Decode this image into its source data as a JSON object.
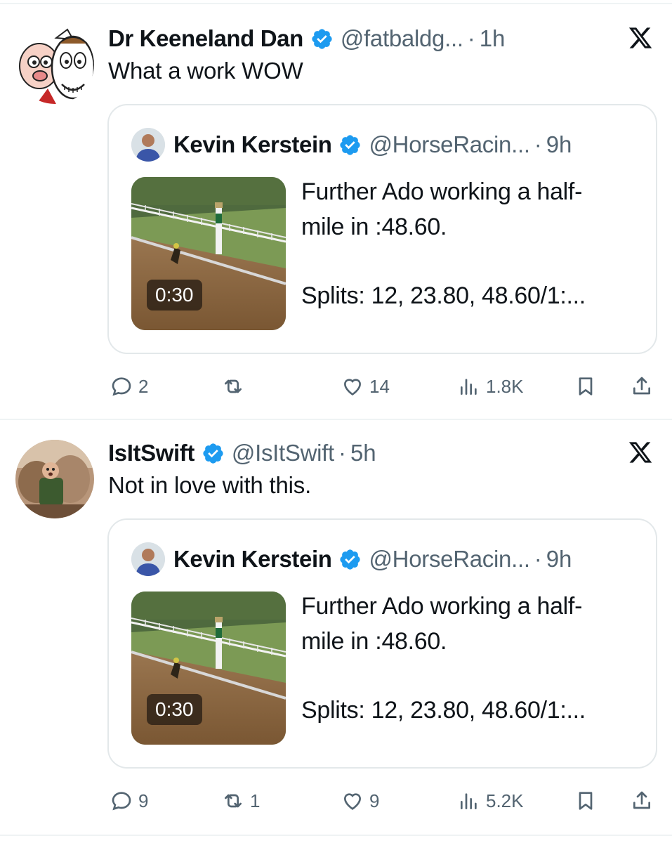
{
  "tweets": [
    {
      "author_name": "Dr Keeneland Dan",
      "author_handle": "@fatbaldg...",
      "time": "1h",
      "text": "What a work WOW",
      "quote": {
        "author_name": "Kevin Kerstein",
        "author_handle": "@HorseRacin...",
        "time": "9h",
        "line1": "Further Ado working a half-",
        "line2": "mile in :48.60.",
        "line3": "Splits: 12, 23.80, 48.60/1:...",
        "video_duration": "0:30"
      },
      "actions": {
        "replies": "2",
        "reposts": "",
        "likes": "14",
        "views": "1.8K"
      }
    },
    {
      "author_name": "IsItSwift",
      "author_handle": "@IsItSwift",
      "time": "5h",
      "text": "Not in love with this.",
      "quote": {
        "author_name": "Kevin Kerstein",
        "author_handle": "@HorseRacin...",
        "time": "9h",
        "line1": "Further Ado working a half-",
        "line2": "mile in :48.60.",
        "line3": "Splits: 12, 23.80, 48.60/1:...",
        "video_duration": "0:30"
      },
      "actions": {
        "replies": "9",
        "reposts": "1",
        "likes": "9",
        "views": "5.2K"
      }
    }
  ],
  "separator": "·",
  "colors": {
    "text": "#0f1419",
    "muted": "#536471",
    "verified": "#1d9bf0",
    "border": "#e3e8ea"
  },
  "icons": [
    "x-logo-icon",
    "verified-badge-icon",
    "reply-icon",
    "repost-icon",
    "like-icon",
    "views-icon",
    "bookmark-icon",
    "share-icon"
  ]
}
